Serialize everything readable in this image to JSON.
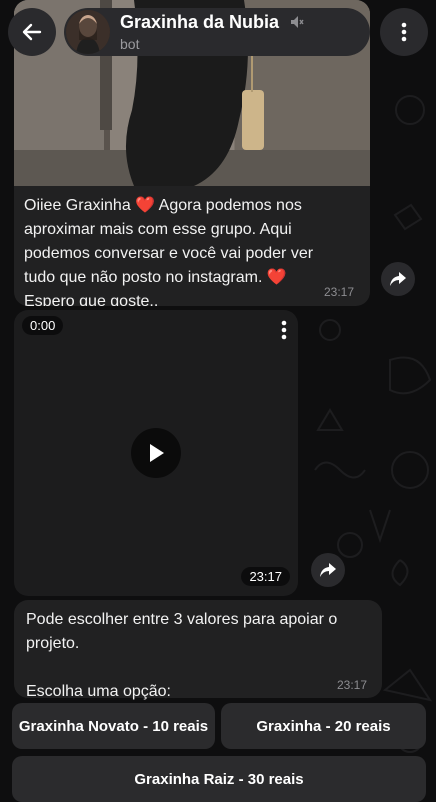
{
  "header": {
    "back_icon": "arrow-left-icon",
    "chat_name": "Graxinha da Nubia",
    "muted_icon": "muted-speaker-icon",
    "subtitle": "bot",
    "menu_icon": "more-vertical-icon"
  },
  "messages": [
    {
      "type": "photo_text",
      "text_lines": [
        "Oiiee Graxinha ❤️ Agora podemos nos",
        "aproximar mais com esse grupo. Aqui",
        "podemos conversar e você vai poder ver",
        "tudo que não posto no instagram. ❤️",
        "Espero que goste.."
      ],
      "time": "23:17",
      "share_icon": "share-arrow-icon"
    },
    {
      "type": "video",
      "duration": "0:00",
      "time": "23:17",
      "play_icon": "play-icon",
      "menu_icon": "more-vertical-icon",
      "share_icon": "share-arrow-icon"
    },
    {
      "type": "text",
      "text_lines": [
        "Pode escolher entre 3 valores para apoiar o",
        "projeto.",
        "",
        "Escolha uma opção:"
      ],
      "time": "23:17"
    }
  ],
  "keyboard": {
    "rows": [
      [
        "Graxinha Novato - 10 reais",
        "Graxinha - 20 reais"
      ],
      [
        "Graxinha Raiz  - 30 reais"
      ]
    ]
  },
  "colors": {
    "background": "#0e0e0f",
    "bubble": "#212122",
    "button": "#2b2b2d",
    "time_text": "#8d8d91"
  }
}
